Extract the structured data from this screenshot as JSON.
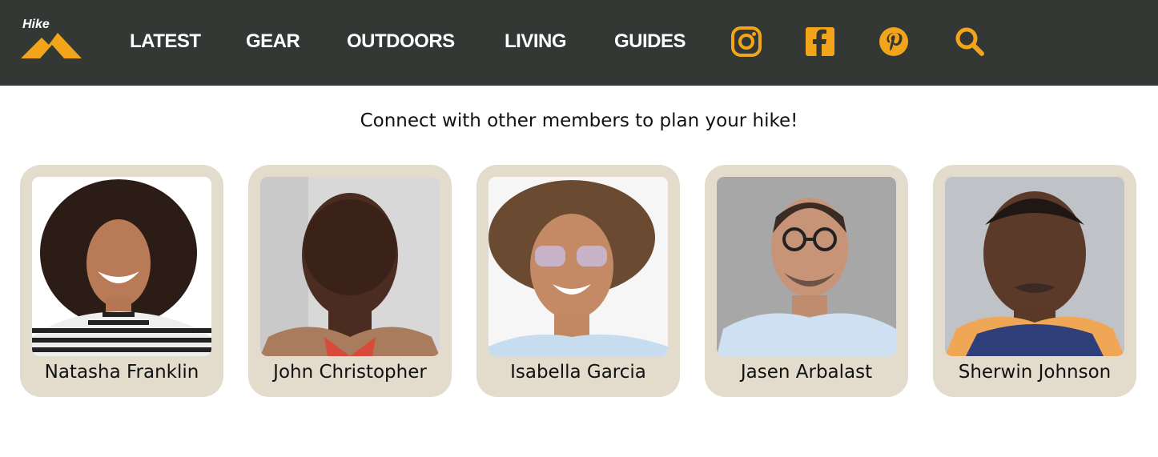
{
  "brand": {
    "logo_text": "Hike"
  },
  "nav": {
    "items": [
      "LATEST",
      "GEAR",
      "OUTDOORS",
      "LIVING",
      "GUIDES"
    ],
    "icons": [
      "instagram-icon",
      "facebook-icon",
      "pinterest-icon",
      "search-icon"
    ]
  },
  "colors": {
    "topbar": "#333835",
    "accent": "#f2a51a",
    "card": "#e3dccc"
  },
  "main": {
    "headline": "Connect with other members to plan your hike!",
    "members": [
      {
        "name": "Natasha Franklin"
      },
      {
        "name": "John Christopher"
      },
      {
        "name": "Isabella Garcia"
      },
      {
        "name": "Jasen Arbalast"
      },
      {
        "name": "Sherwin Johnson"
      }
    ]
  }
}
